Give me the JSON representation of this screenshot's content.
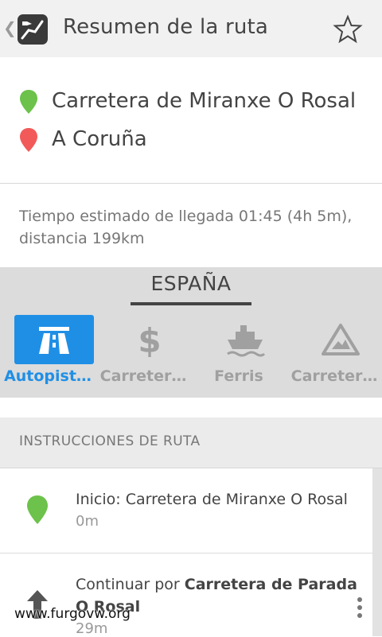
{
  "header": {
    "back_glyph": "❮",
    "app_icon": "route-planner-app-icon",
    "title": "Resumen de la ruta",
    "star_icon": "star-outline-icon"
  },
  "route": {
    "origin_icon": "green-pin-icon",
    "origin": "Carretera de Miranxe  O Rosal",
    "destination_icon": "red-pin-icon",
    "destination": "A Coruña",
    "eta": "Tiempo estimado de llegada 01:45 (4h 5m), distancia 199km"
  },
  "country": {
    "name": "ESPAÑA",
    "options": [
      {
        "label": "Autopist…",
        "icon": "highway-icon",
        "active": true
      },
      {
        "label": "Carreter…",
        "icon": "dollar-toll-icon",
        "active": false
      },
      {
        "label": "Ferris",
        "icon": "ferry-icon",
        "active": false
      },
      {
        "label": "Carreter…",
        "icon": "unpaved-road-warning-icon",
        "active": false
      }
    ]
  },
  "instructions": {
    "header": "INSTRUCCIONES DE RUTA",
    "items": [
      {
        "icon": "green-pin-icon",
        "text": "Inicio: Carretera de Miranxe O Rosal",
        "distance": "0m"
      },
      {
        "icon": "arrow-up-icon",
        "prefix": "Continuar por ",
        "bold": "Carretera de Parada O Rosal",
        "distance": "29m"
      }
    ]
  },
  "watermark": "www.furgovw.org",
  "colors": {
    "accent": "#1f8fe6",
    "origin_pin": "#6cc24a",
    "destination_pin": "#f25a5a",
    "appbar": "#f1f1f1",
    "panel": "#dcdcdc"
  }
}
